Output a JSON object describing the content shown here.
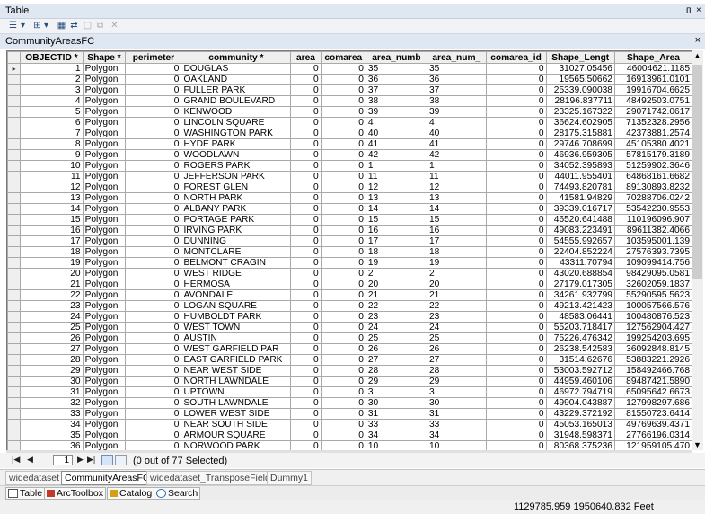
{
  "window": {
    "title": "Table",
    "pin_glyph": "ᴨ",
    "close_glyph": "×"
  },
  "table": {
    "name": "CommunityAreasFC",
    "close_glyph": "×"
  },
  "columns": [
    "OBJECTID *",
    "Shape *",
    "perimeter",
    "community *",
    "area",
    "comarea",
    "area_numb",
    "area_num_",
    "comarea_id",
    "Shape_Lengt",
    "Shape_Area"
  ],
  "rows": [
    [
      "1",
      "Polygon",
      "0",
      "DOUGLAS",
      "0",
      "0",
      "35",
      "35",
      "0",
      "31027.05456",
      "46004621.1185"
    ],
    [
      "2",
      "Polygon",
      "0",
      "OAKLAND",
      "0",
      "0",
      "36",
      "36",
      "0",
      "19565.50662",
      "16913961.0101"
    ],
    [
      "3",
      "Polygon",
      "0",
      "FULLER PARK",
      "0",
      "0",
      "37",
      "37",
      "0",
      "25339.090038",
      "19916704.6625"
    ],
    [
      "4",
      "Polygon",
      "0",
      "GRAND BOULEVARD",
      "0",
      "0",
      "38",
      "38",
      "0",
      "28196.837711",
      "48492503.0751"
    ],
    [
      "5",
      "Polygon",
      "0",
      "KENWOOD",
      "0",
      "0",
      "39",
      "39",
      "0",
      "23325.167322",
      "29071742.0617"
    ],
    [
      "6",
      "Polygon",
      "0",
      "LINCOLN SQUARE",
      "0",
      "0",
      "4",
      "4",
      "0",
      "36624.602905",
      "71352328.2956"
    ],
    [
      "7",
      "Polygon",
      "0",
      "WASHINGTON PARK",
      "0",
      "0",
      "40",
      "40",
      "0",
      "28175.315881",
      "42373881.2574"
    ],
    [
      "8",
      "Polygon",
      "0",
      "HYDE PARK",
      "0",
      "0",
      "41",
      "41",
      "0",
      "29746.708699",
      "45105380.4021"
    ],
    [
      "9",
      "Polygon",
      "0",
      "WOODLAWN",
      "0",
      "0",
      "42",
      "42",
      "0",
      "46936.959305",
      "57815179.3189"
    ],
    [
      "10",
      "Polygon",
      "0",
      "ROGERS PARK",
      "0",
      "0",
      "1",
      "1",
      "0",
      "34052.395893",
      "51259902.3646"
    ],
    [
      "11",
      "Polygon",
      "0",
      "JEFFERSON PARK",
      "0",
      "0",
      "11",
      "11",
      "0",
      "44011.955401",
      "64868161.6682"
    ],
    [
      "12",
      "Polygon",
      "0",
      "FOREST GLEN",
      "0",
      "0",
      "12",
      "12",
      "0",
      "74493.820781",
      "89130893.8232"
    ],
    [
      "13",
      "Polygon",
      "0",
      "NORTH PARK",
      "0",
      "0",
      "13",
      "13",
      "0",
      "41581.94829",
      "70288706.0242"
    ],
    [
      "14",
      "Polygon",
      "0",
      "ALBANY PARK",
      "0",
      "0",
      "14",
      "14",
      "0",
      "39339.016717",
      "53542230.9553"
    ],
    [
      "15",
      "Polygon",
      "0",
      "PORTAGE PARK",
      "0",
      "0",
      "15",
      "15",
      "0",
      "46520.641488",
      "110196096.907"
    ],
    [
      "16",
      "Polygon",
      "0",
      "IRVING PARK",
      "0",
      "0",
      "16",
      "16",
      "0",
      "49083.223491",
      "89611382.4066"
    ],
    [
      "17",
      "Polygon",
      "0",
      "DUNNING",
      "0",
      "0",
      "17",
      "17",
      "0",
      "54555.992657",
      "103595001.139"
    ],
    [
      "18",
      "Polygon",
      "0",
      "MONTCLARE",
      "0",
      "0",
      "18",
      "18",
      "0",
      "22404.852224",
      "27576393.7395"
    ],
    [
      "19",
      "Polygon",
      "0",
      "BELMONT CRAGIN",
      "0",
      "0",
      "19",
      "19",
      "0",
      "43311.70794",
      "109099414.756"
    ],
    [
      "20",
      "Polygon",
      "0",
      "WEST RIDGE",
      "0",
      "0",
      "2",
      "2",
      "0",
      "43020.688854",
      "98429095.0581"
    ],
    [
      "21",
      "Polygon",
      "0",
      "HERMOSA",
      "0",
      "0",
      "20",
      "20",
      "0",
      "27179.017305",
      "32602059.1837"
    ],
    [
      "22",
      "Polygon",
      "0",
      "AVONDALE",
      "0",
      "0",
      "21",
      "21",
      "0",
      "34261.932799",
      "55290595.5623"
    ],
    [
      "23",
      "Polygon",
      "0",
      "LOGAN SQUARE",
      "0",
      "0",
      "22",
      "22",
      "0",
      "49213.421423",
      "100057566.576"
    ],
    [
      "24",
      "Polygon",
      "0",
      "HUMBOLDT PARK",
      "0",
      "0",
      "23",
      "23",
      "0",
      "48583.06441",
      "100480876.523"
    ],
    [
      "25",
      "Polygon",
      "0",
      "WEST TOWN",
      "0",
      "0",
      "24",
      "24",
      "0",
      "55203.718417",
      "127562904.427"
    ],
    [
      "26",
      "Polygon",
      "0",
      "AUSTIN",
      "0",
      "0",
      "25",
      "25",
      "0",
      "75226.476342",
      "199254203.695"
    ],
    [
      "27",
      "Polygon",
      "0",
      "WEST GARFIELD PAR",
      "0",
      "0",
      "26",
      "26",
      "0",
      "26238.542583",
      "36092848.8145"
    ],
    [
      "28",
      "Polygon",
      "0",
      "EAST GARFIELD PARK",
      "0",
      "0",
      "27",
      "27",
      "0",
      "31514.62676",
      "53883221.2926"
    ],
    [
      "29",
      "Polygon",
      "0",
      "NEAR WEST SIDE",
      "0",
      "0",
      "28",
      "28",
      "0",
      "53003.592712",
      "158492466.768"
    ],
    [
      "30",
      "Polygon",
      "0",
      "NORTH LAWNDALE",
      "0",
      "0",
      "29",
      "29",
      "0",
      "44959.460106",
      "89487421.5890"
    ],
    [
      "31",
      "Polygon",
      "0",
      "UPTOWN",
      "0",
      "0",
      "3",
      "3",
      "0",
      "46972.794719",
      "65095642.6673"
    ],
    [
      "32",
      "Polygon",
      "0",
      "SOUTH LAWNDALE",
      "0",
      "0",
      "30",
      "30",
      "0",
      "49904.043887",
      "127998297.686"
    ],
    [
      "33",
      "Polygon",
      "0",
      "LOWER WEST SIDE",
      "0",
      "0",
      "31",
      "31",
      "0",
      "43229.372192",
      "81550723.6414"
    ],
    [
      "34",
      "Polygon",
      "0",
      "NEAR SOUTH SIDE",
      "0",
      "0",
      "33",
      "33",
      "0",
      "45053.165013",
      "49769639.4371"
    ],
    [
      "35",
      "Polygon",
      "0",
      "ARMOUR SQUARE",
      "0",
      "0",
      "34",
      "34",
      "0",
      "31948.598371",
      "27766196.0314"
    ],
    [
      "36",
      "Polygon",
      "0",
      "NORWOOD PARK",
      "0",
      "0",
      "10",
      "10",
      "0",
      "80368.375236",
      "121959105.470"
    ]
  ],
  "current_record": "1",
  "selection_text": "(0 out of 77 Selected)",
  "tabs": [
    "widedataset",
    "CommunityAreasFC",
    "widedataset_TransposeFields",
    "Dummy1"
  ],
  "active_tab": "CommunityAreasFC",
  "dock_items": [
    "Table",
    "ArcToolbox",
    "Catalog",
    "Search"
  ],
  "status_coords": "1129785.959  1950640.832 Feet",
  "colors": {
    "panel_header": "#dfe7f2",
    "grid_header": "#efefef",
    "active_view": "#d6e4f5"
  }
}
